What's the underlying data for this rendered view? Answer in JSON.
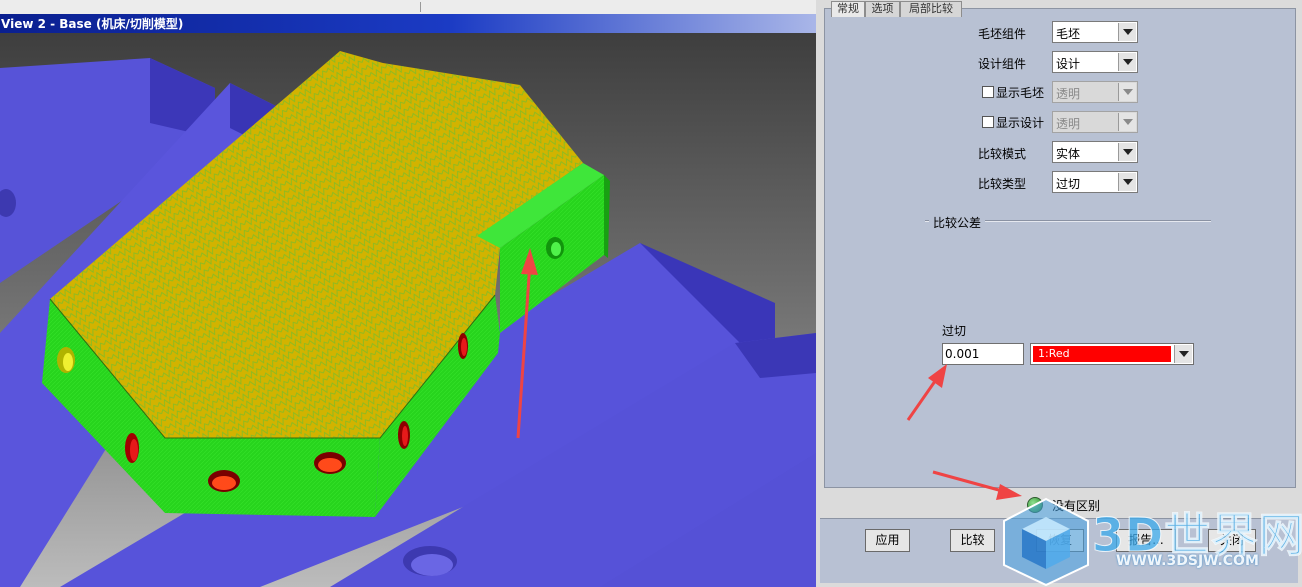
{
  "viewport": {
    "title": "View 2 - Base (机床/切削模型)"
  },
  "panel": {
    "tabs": [
      "常规",
      "选项",
      "局部比较"
    ],
    "rows": [
      {
        "label": "毛坯组件",
        "value": "毛坯",
        "has_checkbox": false,
        "enabled": true
      },
      {
        "label": "设计组件",
        "value": "设计",
        "has_checkbox": false,
        "enabled": true
      },
      {
        "label": "显示毛坯",
        "value": "透明",
        "has_checkbox": true,
        "enabled": false
      },
      {
        "label": "显示设计",
        "value": "透明",
        "has_checkbox": true,
        "enabled": false
      },
      {
        "label": "比较模式",
        "value": "实体",
        "has_checkbox": false,
        "enabled": true
      },
      {
        "label": "比较类型",
        "value": "过切",
        "has_checkbox": false,
        "enabled": true
      }
    ],
    "tolerance_group_title": "比较公差",
    "tolerance": {
      "label": "过切",
      "value": "0.001",
      "color_value": "1:Red",
      "color_hex": "#ff0000"
    },
    "status": {
      "text": "没有区别",
      "indicator_color": "#2e9e2e"
    },
    "buttons": {
      "apply": "应用",
      "compare": "比较",
      "restore": "恢复",
      "report": "报告...",
      "close": "关闭"
    }
  },
  "watermark": {
    "title": "3D世界网",
    "url": "WWW.3DSJW.COM"
  },
  "colors": {
    "fixture_blue": "#5a55d6",
    "part_top_yellow": "#d4b400",
    "part_side_green": "#22d31c",
    "background_gray": "#6e6e6e",
    "annotation_red": "#ef4444"
  }
}
